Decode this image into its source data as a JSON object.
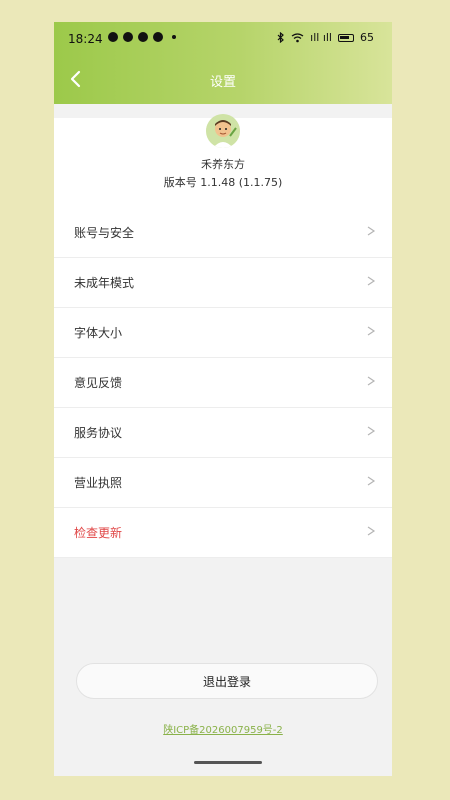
{
  "status_bar": {
    "time": "18:24",
    "left_icons": [
      "notification-icon",
      "chat-icon",
      "message-icon",
      "alert-icon"
    ],
    "signal": "ıll ıll",
    "battery": "65"
  },
  "nav": {
    "title": "设置"
  },
  "profile": {
    "app_name": "禾养东方",
    "version": "版本号 1.1.48 (1.1.75)"
  },
  "menu": [
    {
      "label": "账号与安全",
      "danger": false
    },
    {
      "label": "未成年模式",
      "danger": false
    },
    {
      "label": "字体大小",
      "danger": false
    },
    {
      "label": "意见反馈",
      "danger": false
    },
    {
      "label": "服务协议",
      "danger": false
    },
    {
      "label": "营业执照",
      "danger": false
    },
    {
      "label": "检查更新",
      "danger": true
    }
  ],
  "logout_label": "退出登录",
  "icp": "陕ICP备2026007959号-2",
  "colors": {
    "accent": "#9cc94a",
    "danger": "#e04646",
    "link": "#8ab24a"
  }
}
